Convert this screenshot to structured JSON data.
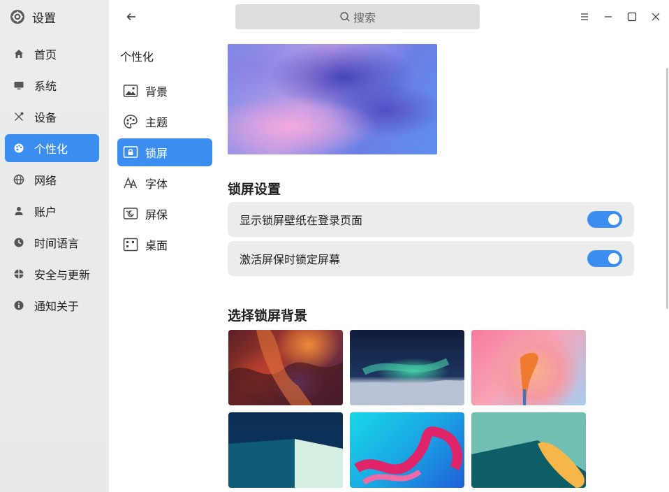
{
  "app": {
    "title": "设置",
    "icon": "gear-icon"
  },
  "nav": {
    "items": [
      {
        "label": "首页",
        "icon": "home-icon"
      },
      {
        "label": "系统",
        "icon": "monitor-icon"
      },
      {
        "label": "设备",
        "icon": "tools-icon"
      },
      {
        "label": "个性化",
        "icon": "palette-icon",
        "active": true
      },
      {
        "label": "网络",
        "icon": "globe-icon"
      },
      {
        "label": "账户",
        "icon": "user-icon"
      },
      {
        "label": "时间语言",
        "icon": "clock-icon"
      },
      {
        "label": "安全与更新",
        "icon": "shield-icon"
      },
      {
        "label": "通知关于",
        "icon": "info-icon"
      }
    ]
  },
  "subnav": {
    "title": "个性化",
    "items": [
      {
        "label": "背景",
        "icon": "image-icon"
      },
      {
        "label": "主题",
        "icon": "palette-icon"
      },
      {
        "label": "锁屏",
        "icon": "lockscreen-icon",
        "active": true
      },
      {
        "label": "字体",
        "icon": "font-icon"
      },
      {
        "label": "屏保",
        "icon": "screensaver-icon"
      },
      {
        "label": "桌面",
        "icon": "desktop-icon"
      }
    ]
  },
  "search": {
    "placeholder": "搜索"
  },
  "lock_settings": {
    "title": "锁屏设置",
    "rows": [
      {
        "label": "显示锁屏壁纸在登录页面",
        "enabled": true
      },
      {
        "label": "激活屏保时锁定屏幕",
        "enabled": true
      }
    ]
  },
  "backgrounds": {
    "title": "选择锁屏背景"
  },
  "colors": {
    "accent": "#3b8ef0",
    "sidebar_bg": "#ececec",
    "row_bg": "#ececec"
  }
}
